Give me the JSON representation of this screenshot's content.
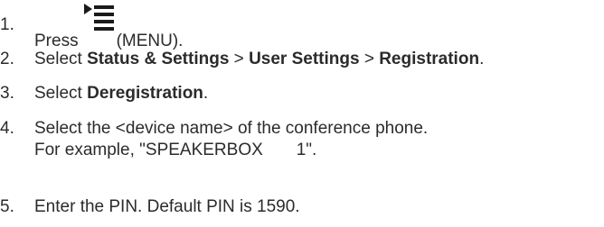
{
  "steps": [
    {
      "num": "1.",
      "text_before": "Press",
      "icon": "menu-icon",
      "text_after": "(MENU)."
    },
    {
      "num": "2.",
      "prefix": "Select ",
      "part1": "Status & Settings",
      "sep1": " > ",
      "part2": "User Settings",
      "sep2": " > ",
      "part3": "Registration",
      "suffix": "."
    },
    {
      "num": "3.",
      "prefix": "Select ",
      "part1": "Deregistration",
      "suffix": "."
    },
    {
      "num": "4.",
      "line1": "Select the <device name> of the conference phone.",
      "line2": "For example, \"SPEAKERBOX       1\"."
    },
    {
      "num": "5.",
      "line1": "Enter the PIN. Default PIN is 1590."
    }
  ]
}
